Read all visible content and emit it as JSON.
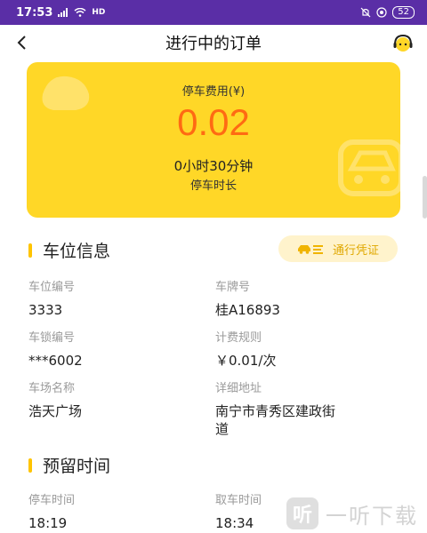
{
  "status_bar": {
    "time": "17:53",
    "network": "HD",
    "battery": "52"
  },
  "nav": {
    "title": "进行中的订单"
  },
  "fee_card": {
    "fee_label": "停车费用(¥)",
    "amount": "0.02",
    "duration": "0小时30分钟",
    "duration_label": "停车时长"
  },
  "spot_section": {
    "title": "车位信息",
    "pass_button": "通行凭证",
    "fields": [
      {
        "label": "车位编号",
        "value": "3333"
      },
      {
        "label": "车牌号",
        "value": "桂A16893"
      },
      {
        "label": "车锁编号",
        "value": "***6002"
      },
      {
        "label": "计费规则",
        "value": "￥0.01/次"
      },
      {
        "label": "车场名称",
        "value": "浩天广场"
      },
      {
        "label": "详细地址",
        "value_line1": "南宁市青秀区建政街",
        "value_line2": "道"
      }
    ]
  },
  "reserve_section": {
    "title": "预留时间",
    "fields": [
      {
        "label": "停车时间",
        "value": "18:19"
      },
      {
        "label": "取车时间",
        "value": "18:34"
      }
    ]
  },
  "watermark": {
    "logo": "听",
    "text": "一听下载"
  },
  "colors": {
    "status_bar": "#5a2ea6",
    "card_yellow": "#ffd727",
    "amount_orange": "#ff6a13",
    "accent_yellow": "#ffc400"
  },
  "icons": [
    "signal-icon",
    "wifi-icon",
    "back-arrow-icon",
    "customer-service-icon",
    "car-icon",
    "car-deco-icon"
  ]
}
